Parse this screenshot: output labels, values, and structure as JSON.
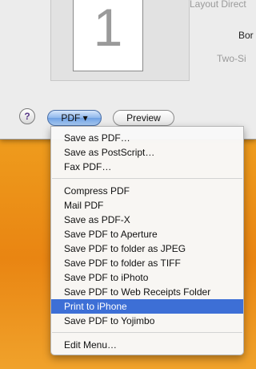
{
  "preview": {
    "page_number": "1"
  },
  "options": {
    "layout_direction": "Layout Direct",
    "border": "Bor",
    "two_sided": "Two-Si"
  },
  "buttons": {
    "help": "?",
    "pdf": "PDF ▾",
    "preview": "Preview"
  },
  "menu": {
    "group1": [
      "Save as PDF…",
      "Save as PostScript…",
      "Fax PDF…"
    ],
    "group2": [
      "Compress PDF",
      "Mail PDF",
      "Save as PDF-X",
      "Save PDF to Aperture",
      "Save PDF to folder as JPEG",
      "Save PDF to folder as TIFF",
      "Save PDF to iPhoto",
      "Save PDF to Web Receipts Folder",
      "Print to iPhone",
      "Save PDF to Yojimbo"
    ],
    "group3": [
      "Edit Menu…"
    ],
    "selected": "Print to iPhone"
  }
}
